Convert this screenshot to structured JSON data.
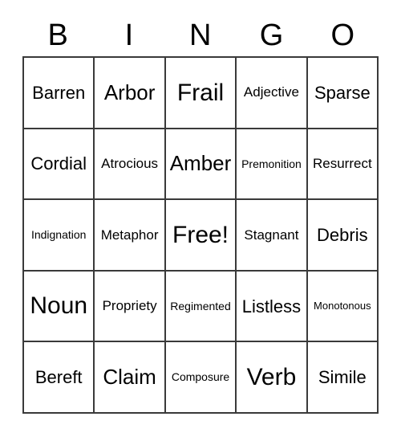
{
  "card": {
    "header_letters": [
      "B",
      "I",
      "N",
      "G",
      "O"
    ],
    "free_space_label": "Free!",
    "grid_line_color": "#3a3a3a",
    "background_color": "#ffffff",
    "text_color": "#000000",
    "rows": [
      [
        {
          "label": "Barren",
          "size": "md"
        },
        {
          "label": "Arbor",
          "size": "lg"
        },
        {
          "label": "Frail",
          "size": "xl"
        },
        {
          "label": "Adjective",
          "size": "sm"
        },
        {
          "label": "Sparse",
          "size": "md"
        }
      ],
      [
        {
          "label": "Cordial",
          "size": "md"
        },
        {
          "label": "Atrocious",
          "size": "sm"
        },
        {
          "label": "Amber",
          "size": "lg"
        },
        {
          "label": "Premonition",
          "size": "xs"
        },
        {
          "label": "Resurrect",
          "size": "sm"
        }
      ],
      [
        {
          "label": "Indignation",
          "size": "xs"
        },
        {
          "label": "Metaphor",
          "size": "sm"
        },
        {
          "label": "Free!",
          "size": "xl"
        },
        {
          "label": "Stagnant",
          "size": "sm"
        },
        {
          "label": "Debris",
          "size": "md"
        }
      ],
      [
        {
          "label": "Noun",
          "size": "xl"
        },
        {
          "label": "Propriety",
          "size": "sm"
        },
        {
          "label": "Regimented",
          "size": "xs"
        },
        {
          "label": "Listless",
          "size": "md"
        },
        {
          "label": "Monotonous",
          "size": "xxs"
        }
      ],
      [
        {
          "label": "Bereft",
          "size": "md"
        },
        {
          "label": "Claim",
          "size": "lg"
        },
        {
          "label": "Composure",
          "size": "xs"
        },
        {
          "label": "Verb",
          "size": "xl"
        },
        {
          "label": "Simile",
          "size": "md"
        }
      ]
    ]
  }
}
